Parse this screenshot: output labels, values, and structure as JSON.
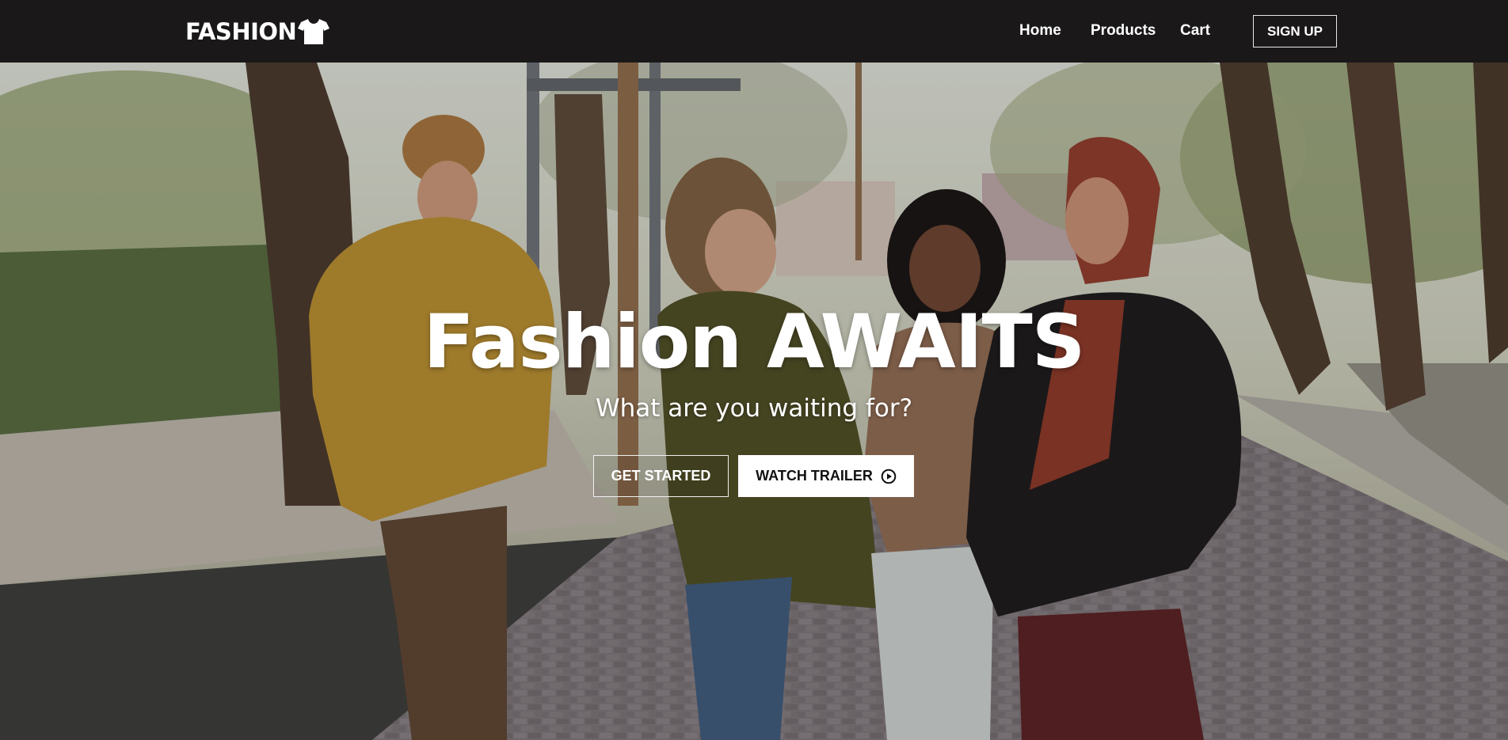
{
  "brand": {
    "name": "FASHION",
    "logo_icon": "tshirt-icon"
  },
  "nav": {
    "items": [
      {
        "label": "Home"
      },
      {
        "label": "Products"
      },
      {
        "label": "Cart"
      }
    ],
    "signup_label": "SIGN UP"
  },
  "hero": {
    "title": "Fashion AWAITS",
    "subtitle": "What are you waiting for?",
    "primary_button": "GET STARTED",
    "secondary_button": "WATCH TRAILER",
    "secondary_icon": "play-circle-icon"
  },
  "colors": {
    "navbar_bg": "#1a1819",
    "text": "#ffffff",
    "button_light_bg": "#ffffff"
  }
}
